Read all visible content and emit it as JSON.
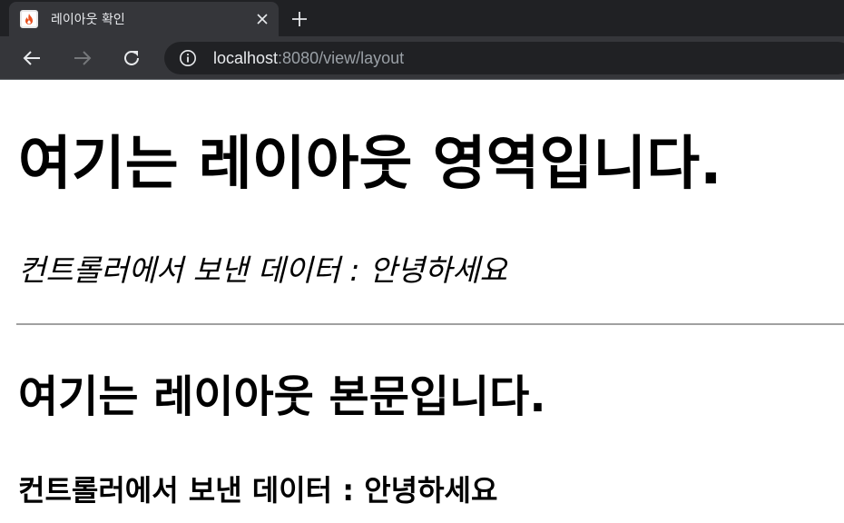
{
  "browser": {
    "tab": {
      "title": "레이아웃 확인",
      "favicon": "flame-favicon-icon"
    },
    "toolbar": {
      "url_host": "localhost",
      "url_rest": ":8080/view/layout",
      "back_icon": "back-arrow-icon",
      "forward_icon": "forward-arrow-icon",
      "reload_icon": "reload-icon",
      "info_icon": "info-icon"
    },
    "colors": {
      "tabstrip": "#202124",
      "toolbar": "#35363a",
      "favicon_flame": "#e8501f"
    }
  },
  "page": {
    "layout_heading": "여기는 레이아웃 영역입니다.",
    "layout_data_line": "컨트롤러에서 보낸 데이터 : 안녕하세요",
    "body_heading": "여기는 레이아웃 본문입니다.",
    "body_data_line": "컨트롤러에서 보낸 데이터 : 안녕하세요"
  }
}
